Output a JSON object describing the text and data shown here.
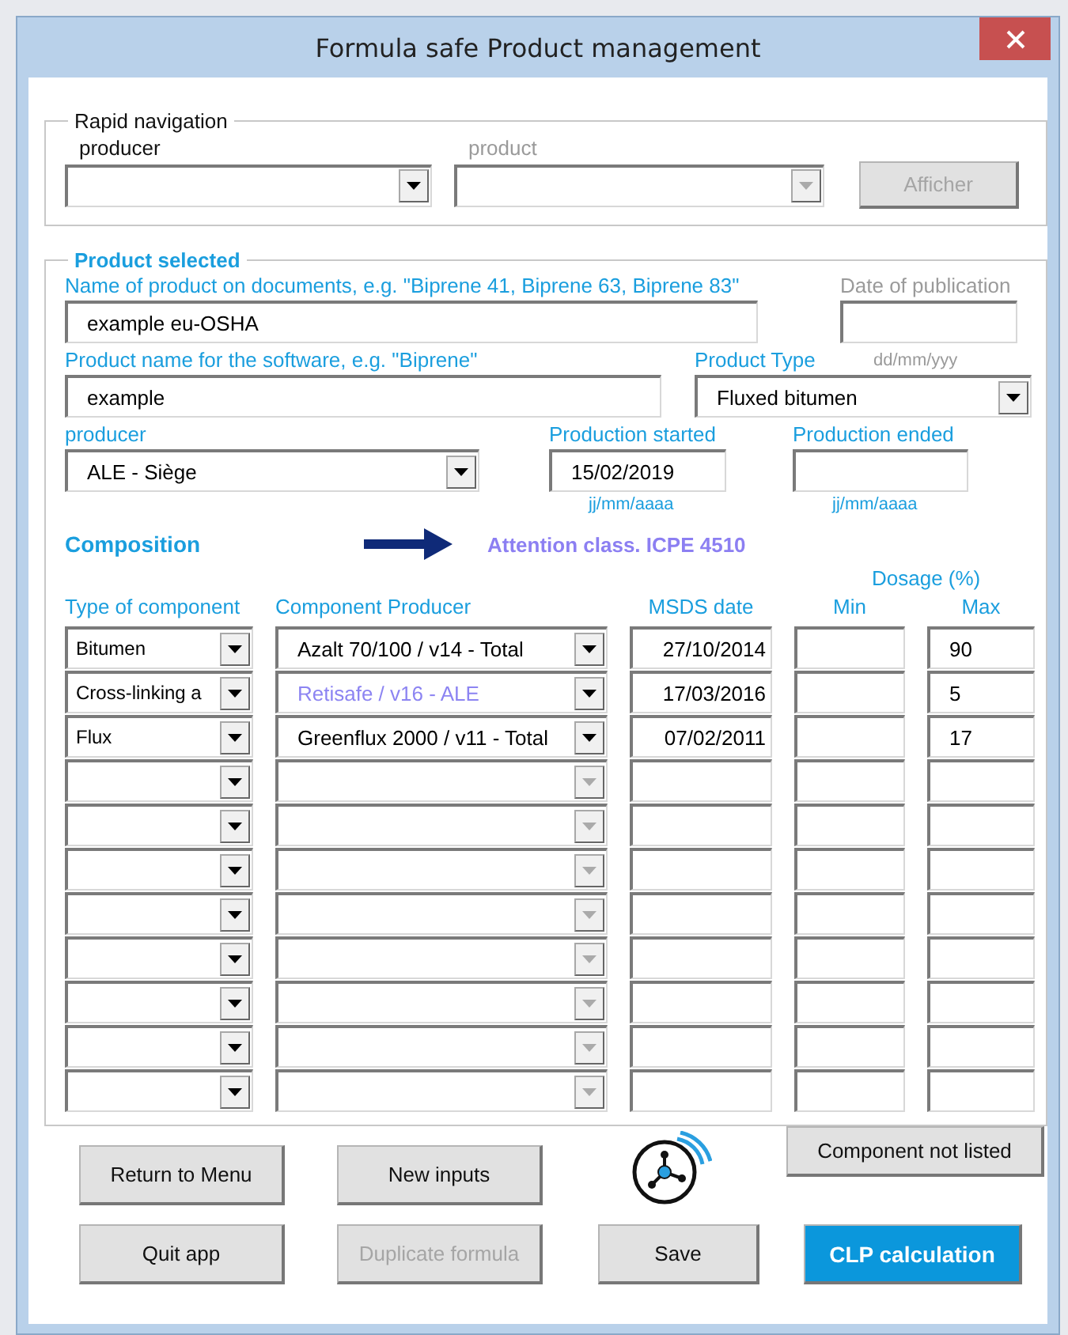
{
  "window": {
    "title": "Formula safe Product management"
  },
  "rapid_navigation": {
    "legend": "Rapid navigation",
    "producer_label": "producer",
    "product_label": "product",
    "producer_disabled": false,
    "product_disabled": true,
    "show_button": {
      "label": "Afficher",
      "disabled": true
    }
  },
  "product_selected": {
    "legend": "Product selected",
    "name_label": "Name of product on documents, e.g. \"Biprene 41, Biprene 63, Biprene 83\"",
    "name_value": "example eu-OSHA",
    "publication_label": "Date of publication",
    "publication_hint": "dd/mm/yyy",
    "software_label": "Product name for the software, e.g. \"Biprene\"",
    "software_value": "example",
    "type_label": "Product Type",
    "type_value": "Fluxed bitumen",
    "producer_label": "producer",
    "producer_value": "ALE - Siège",
    "started_label": "Production started",
    "started_value": "15/02/2019",
    "started_hint": "jj/mm/aaaa",
    "ended_label": "Production ended",
    "ended_hint": "jj/mm/aaaa"
  },
  "composition": {
    "title": "Composition",
    "attention": "Attention class. ICPE 4510",
    "dosage_label": "Dosage (%)",
    "columns": [
      "Type of component",
      "Component Producer",
      "MSDS date",
      "Min",
      "Max"
    ],
    "rows": [
      {
        "type": "Bitumen",
        "producer": "Azalt 70/100  / v14 - Total",
        "highlighted": false,
        "producer_enabled": true,
        "msds_date": "27/10/2014",
        "max": "90"
      },
      {
        "type": "Cross-linking a",
        "producer": "Retisafe / v16 - ALE",
        "highlighted": true,
        "producer_enabled": true,
        "msds_date": "17/03/2016",
        "max": "5"
      },
      {
        "type": "Flux",
        "producer": "Greenflux 2000 / v11 - Total",
        "highlighted": false,
        "producer_enabled": true,
        "msds_date": "07/02/2011",
        "max": "17"
      },
      {
        "producer_enabled": false
      },
      {
        "producer_enabled": false
      },
      {
        "producer_enabled": false
      },
      {
        "producer_enabled": false
      },
      {
        "producer_enabled": false
      },
      {
        "producer_enabled": false
      },
      {
        "producer_enabled": false
      },
      {
        "producer_enabled": false
      }
    ]
  },
  "buttons": [
    {
      "label": "Return to Menu",
      "kind": "normal"
    },
    {
      "label": "New inputs",
      "kind": "normal"
    },
    {
      "label": "Component not listed",
      "kind": "normal"
    },
    {
      "label": "Quit app",
      "kind": "normal"
    },
    {
      "label": "Duplicate formula",
      "kind": "normal",
      "disabled": true
    },
    {
      "label": "Save",
      "kind": "normal"
    },
    {
      "label": "CLP calculation",
      "kind": "primary"
    }
  ]
}
